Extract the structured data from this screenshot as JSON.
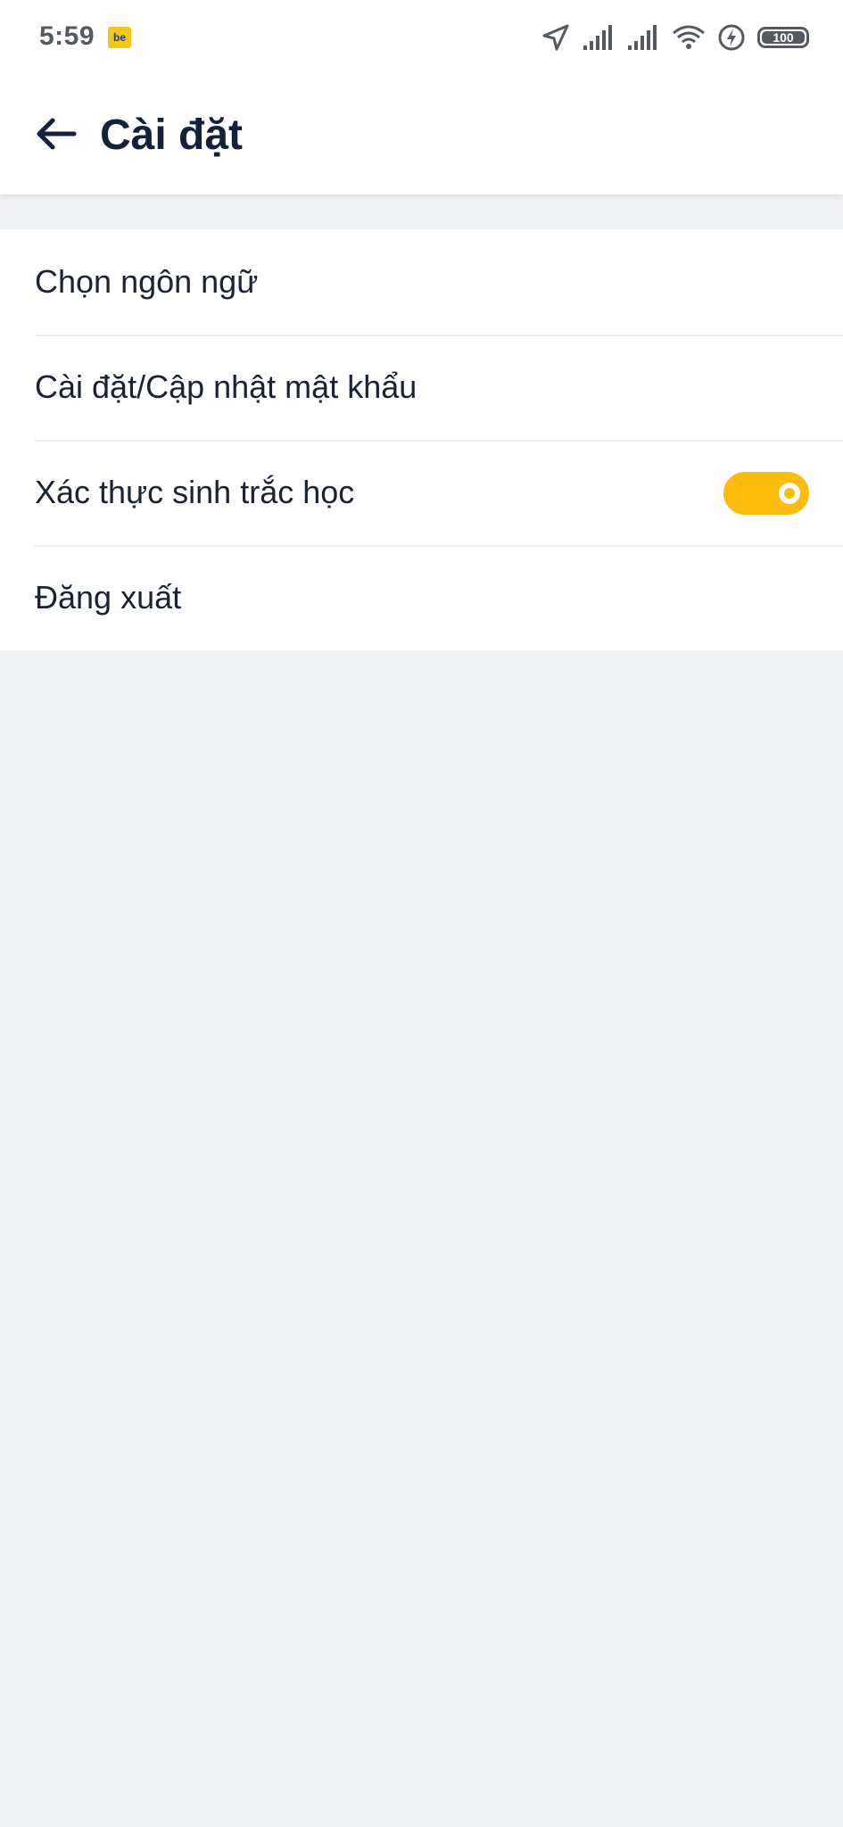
{
  "status_bar": {
    "time": "5:59",
    "app_badge": "be",
    "icons": [
      "location-arrow-icon",
      "signal-bars-icon",
      "signal-bars-icon",
      "wifi-icon",
      "charging-bolt-icon",
      "battery-icon"
    ],
    "battery_level": "100"
  },
  "app_bar": {
    "back_icon": "arrow-left-icon",
    "title": "Cài đặt"
  },
  "settings": {
    "items": [
      {
        "label": "Chọn ngôn ngữ"
      },
      {
        "label": "Cài đặt/Cập nhật mật khẩu"
      },
      {
        "label": "Xác thực sinh trắc học",
        "toggle_on": true
      },
      {
        "label": "Đăng xuất"
      }
    ]
  },
  "colors": {
    "accent": "#fbbc0b",
    "title_text": "#13213a",
    "background": "#f1f2f4"
  }
}
